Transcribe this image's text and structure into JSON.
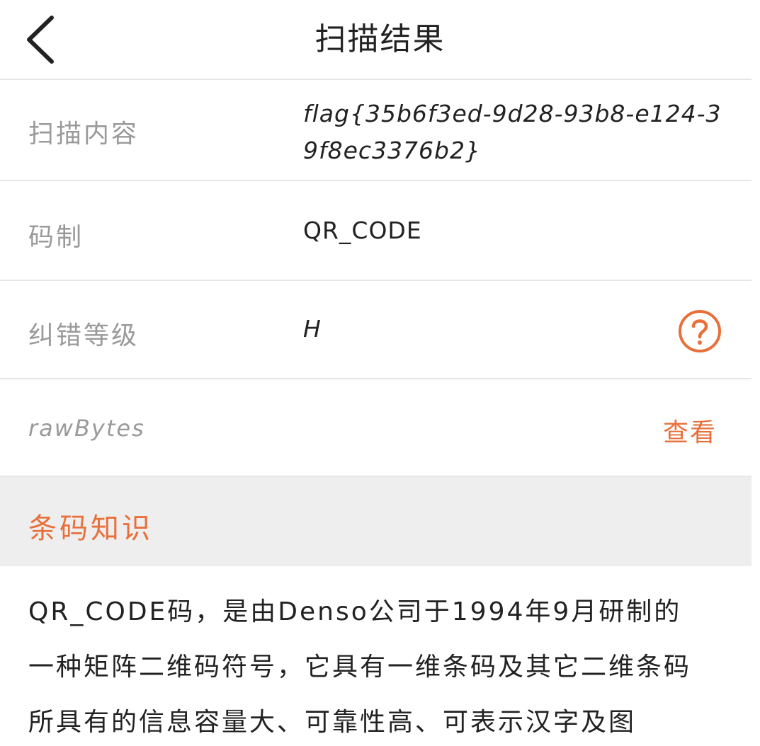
{
  "header": {
    "title": "扫描结果",
    "back_icon": "chevron-left-icon"
  },
  "rows": {
    "content": {
      "label": "扫描内容",
      "value": "flag{35b6f3ed-9d28-93b8-e124-39f8ec3376b2}"
    },
    "symbology": {
      "label": "码制",
      "value": "QR_CODE"
    },
    "error_correction": {
      "label": "纠错等级",
      "value": "H",
      "help_icon": "question-circle-icon"
    },
    "raw_bytes": {
      "label": "rawBytes",
      "action": "查看"
    }
  },
  "knowledge": {
    "title": "条码知识",
    "text": "QR_CODE码，是由Denso公司于1994年9月研制的一种矩阵二维码符号，它具有一维条码及其它二维条码所具有的信息容量大、可靠性高、可表示汉字及图"
  },
  "colors": {
    "accent": "#e8703a",
    "label_gray": "#9a9a9a",
    "divider": "#e6e6e6",
    "section_bg": "#eeeeee"
  }
}
